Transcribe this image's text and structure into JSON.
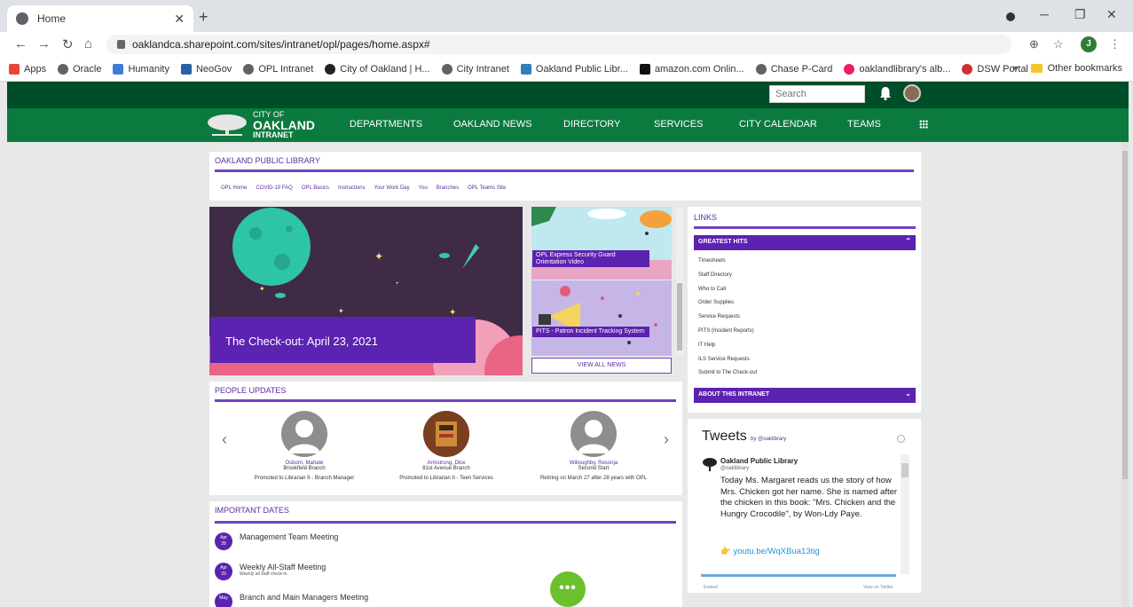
{
  "browser": {
    "tab_title": "Home",
    "tab_close": "✕",
    "new_tab": "+",
    "url": "oaklandca.sharepoint.com/sites/intranet/opl/pages/home.aspx#",
    "profile_initial": "J",
    "bookmarks": [
      {
        "label": "Apps",
        "color": "#e8453c"
      },
      {
        "label": "Oracle",
        "color": "#5f6368"
      },
      {
        "label": "Humanity",
        "color": "#3d7dd8"
      },
      {
        "label": "NeoGov",
        "color": "#2c5fa8"
      },
      {
        "label": "OPL Intranet",
        "color": "#5f6368"
      },
      {
        "label": "City of Oakland | H...",
        "color": "#222222"
      },
      {
        "label": "City Intranet",
        "color": "#5f6368"
      },
      {
        "label": "Oakland Public Libr...",
        "color": "#2f7fb8"
      },
      {
        "label": "amazon.com Onlin...",
        "color": "#111111"
      },
      {
        "label": "Chase P-Card",
        "color": "#5f6368"
      },
      {
        "label": "oaklandlibrary's alb...",
        "color": "#e91e63"
      },
      {
        "label": "DSW Portal",
        "color": "#d32f2f"
      }
    ],
    "more_bookmarks": "»",
    "other_bookmarks": "Other bookmarks"
  },
  "header": {
    "search_placeholder": "Search",
    "logo": {
      "line1": "CITY OF",
      "line2": "OAKLAND",
      "line3": "INTRANET"
    },
    "nav": [
      {
        "label": "DEPARTMENTS"
      },
      {
        "label": "OAKLAND NEWS"
      },
      {
        "label": "DIRECTORY"
      },
      {
        "label": "SERVICES"
      },
      {
        "label": "CITY CALENDAR"
      },
      {
        "label": "TEAMS"
      }
    ]
  },
  "opl": {
    "title": "OAKLAND PUBLIC LIBRARY",
    "subnav": [
      "OPL Home",
      "COVID-19 FAQ",
      "OPL Basics",
      "Instructions",
      "Your Work Day",
      "You",
      "Branches",
      "OPL Teams Site"
    ]
  },
  "news": {
    "hero_title": "The Check-out: April 23, 2021",
    "tile1": "OPL Express Security Guard Orientation Video",
    "tile2": "PITS - Patron Incident Tracking System",
    "view_all": "VIEW ALL NEWS"
  },
  "people": {
    "title": "PEOPLE UPDATES",
    "prev": "‹",
    "next": "›",
    "items": [
      {
        "name": "Osborn, Mahate",
        "branch": "Brookfield Branch",
        "note": "Promoted to Librarian II - Branch Manager"
      },
      {
        "name": "Armstrong, Dice",
        "branch": "81st Avenue Branch",
        "note": "Promoted to Librarian II - Teen Services"
      },
      {
        "name": "Willoughby, Resonja",
        "branch": "Second Start",
        "note": "Retiring on March 27 after 28 years with OPL"
      }
    ]
  },
  "dates": {
    "title": "IMPORTANT DATES",
    "events": [
      {
        "month": "Apr",
        "day": "28",
        "title": "Management Team Meeting",
        "sub": ""
      },
      {
        "month": "Apr",
        "day": "29",
        "title": "Weekly All-Staff Meeting",
        "sub": "Weekly all staff check-in."
      },
      {
        "month": "May",
        "day": "",
        "title": "Branch and Main Managers Meeting",
        "sub": ""
      }
    ],
    "chat_label": "•••"
  },
  "links": {
    "title": "LINKS",
    "greatest_hits": "GREATEST HITS",
    "items": [
      "Timesheets",
      "Staff Directory",
      "Who to Call",
      "Order Supplies",
      "Service Requests",
      "PITS (Incident Reports)",
      "IT Help",
      "ILS Service Requests",
      "Submit to The Check-out"
    ],
    "about": "ABOUT THIS INTRANET"
  },
  "tweets": {
    "heading": "Tweets",
    "by": "by @oaklibrary",
    "account": "Oakland Public Library",
    "handle": "@oaklibrary",
    "text": "Today Ms. Margaret reads us the story of how Mrs. Chicken got her name. She is named after the chicken in this book: \"Mrs. Chicken and the Hungry Crocodile\", by Won-Ldy Paye.",
    "link": "👉 youtu.be/WqXBua13tig",
    "embed": "Embed",
    "view_on_twitter": "View on Twitter"
  }
}
